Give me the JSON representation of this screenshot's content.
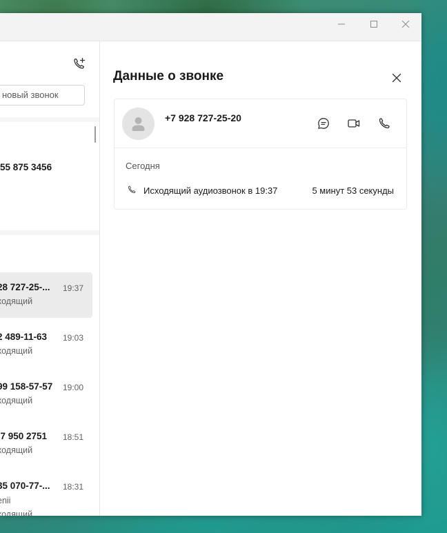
{
  "left": {
    "search_placeholder": "новый звонок",
    "contact_number": "55 875 3456",
    "calls": [
      {
        "number": "28 727-25-...",
        "line1": "ходящий",
        "line2": "",
        "time": "19:37",
        "selected": true
      },
      {
        "number": "2 489-11-63",
        "line1": "ходящий",
        "line2": "",
        "time": "19:03",
        "selected": false
      },
      {
        "number": "99 158-57-57",
        "line1": "ходящий",
        "line2": "",
        "time": "19:00",
        "selected": false
      },
      {
        "number": "-7 950 2751",
        "line1": "ходящий",
        "line2": "",
        "time": "18:51",
        "selected": false
      },
      {
        "number": "35 070-77-...",
        "line1": "enii",
        "line2": "ходящий",
        "time": "18:31",
        "selected": false
      }
    ]
  },
  "detail": {
    "title": "Данные о звонке",
    "phone": "+7 928 727-25-20",
    "day": "Сегодня",
    "log_text": "Исходящий аудиозвонок в 19:37",
    "log_duration": "5 минут 53 секунды"
  },
  "icons": {
    "minimize": "minimize-icon",
    "maximize": "maximize-icon",
    "close": "close-icon",
    "new_call": "phone-plus-icon",
    "chat": "chat-icon",
    "video": "video-icon",
    "phone": "phone-icon"
  }
}
